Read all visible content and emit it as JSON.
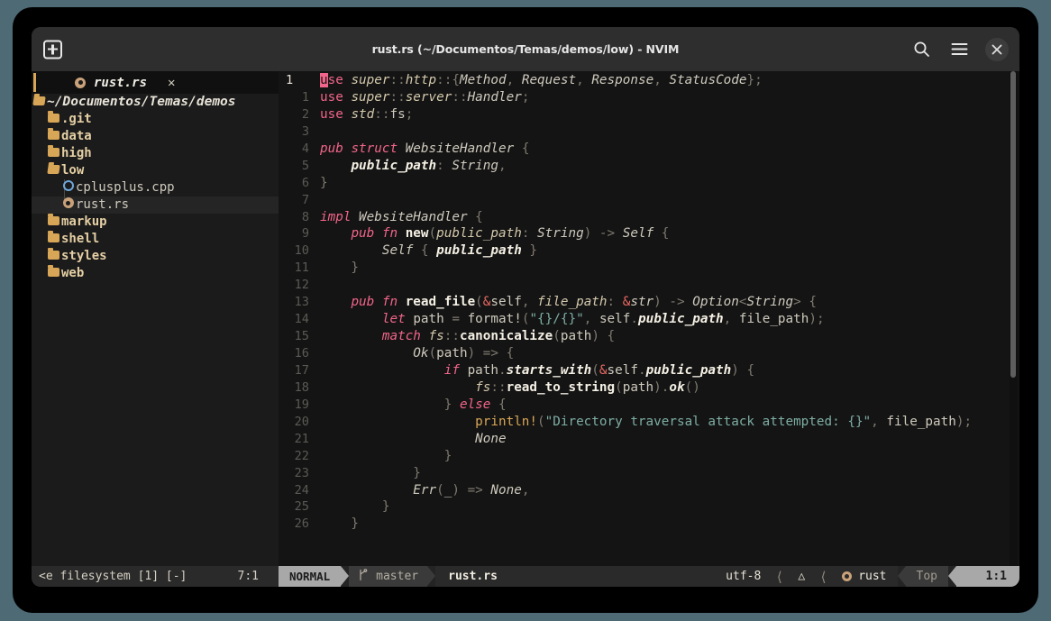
{
  "window": {
    "title": "rust.rs (~/Documentos/Temas/demos/low) - NVIM",
    "new_tab_label": "+",
    "search_icon": "search-icon",
    "menu_icon": "hamburger-menu-icon",
    "close_icon": "close-icon",
    "close_label": "✕"
  },
  "tabline": {
    "tabs": [
      {
        "label": "rust.rs",
        "icon": "rust-file-icon",
        "close_label": "✕",
        "active": true
      }
    ]
  },
  "filetree": {
    "root": {
      "label": "~/Documentos/Temas/demos",
      "icon": "folder-open-icon"
    },
    "items": [
      {
        "label": ".git",
        "icon": "folder-icon",
        "type": "dir",
        "depth": 1,
        "selected": false
      },
      {
        "label": "data",
        "icon": "folder-icon",
        "type": "dir",
        "depth": 1,
        "selected": false
      },
      {
        "label": "high",
        "icon": "folder-icon",
        "type": "dir",
        "depth": 1,
        "selected": false
      },
      {
        "label": "low",
        "icon": "folder-open-icon",
        "type": "dir",
        "depth": 1,
        "selected": false
      },
      {
        "label": "cplusplus.cpp",
        "icon": "cpp-file-icon",
        "type": "file",
        "depth": 2,
        "selected": false
      },
      {
        "label": "rust.rs",
        "icon": "rust-file-icon",
        "type": "file",
        "depth": 2,
        "selected": true
      },
      {
        "label": "markup",
        "icon": "folder-icon",
        "type": "dir",
        "depth": 1,
        "selected": false
      },
      {
        "label": "shell",
        "icon": "folder-icon",
        "type": "dir",
        "depth": 1,
        "selected": false
      },
      {
        "label": "styles",
        "icon": "folder-icon",
        "type": "dir",
        "depth": 1,
        "selected": false
      },
      {
        "label": "web",
        "icon": "folder-icon",
        "type": "dir",
        "depth": 1,
        "selected": false
      }
    ]
  },
  "editor": {
    "language": "rust",
    "cursor_char": "u",
    "lines": [
      {
        "num": "1",
        "current": true,
        "tokens": [
          {
            "t": "u",
            "c": "cursor-blk"
          },
          {
            "t": "se",
            "c": "kw2"
          },
          {
            "t": " ",
            "c": "pl"
          },
          {
            "t": "super",
            "c": "id"
          },
          {
            "t": "::",
            "c": "pn"
          },
          {
            "t": "http",
            "c": "id"
          },
          {
            "t": "::",
            "c": "pn"
          },
          {
            "t": "{",
            "c": "pn"
          },
          {
            "t": "Method",
            "c": "typ"
          },
          {
            "t": ", ",
            "c": "pn"
          },
          {
            "t": "Request",
            "c": "typ"
          },
          {
            "t": ", ",
            "c": "pn"
          },
          {
            "t": "Response",
            "c": "typ"
          },
          {
            "t": ", ",
            "c": "pn"
          },
          {
            "t": "StatusCode",
            "c": "typ"
          },
          {
            "t": "};",
            "c": "pn"
          }
        ]
      },
      {
        "num": "1",
        "current": false,
        "tokens": [
          {
            "t": "use",
            "c": "kw2"
          },
          {
            "t": " ",
            "c": "pl"
          },
          {
            "t": "super",
            "c": "id"
          },
          {
            "t": "::",
            "c": "pn"
          },
          {
            "t": "server",
            "c": "id"
          },
          {
            "t": "::",
            "c": "pn"
          },
          {
            "t": "Handler",
            "c": "typ"
          },
          {
            "t": ";",
            "c": "pn"
          }
        ]
      },
      {
        "num": "2",
        "current": false,
        "tokens": [
          {
            "t": "use",
            "c": "kw2"
          },
          {
            "t": " ",
            "c": "pl"
          },
          {
            "t": "std",
            "c": "id"
          },
          {
            "t": "::",
            "c": "pn"
          },
          {
            "t": "fs",
            "c": "pl"
          },
          {
            "t": ";",
            "c": "pn"
          }
        ]
      },
      {
        "num": "3",
        "current": false,
        "tokens": []
      },
      {
        "num": "4",
        "current": false,
        "tokens": [
          {
            "t": "pub",
            "c": "kw"
          },
          {
            "t": " ",
            "c": "pl"
          },
          {
            "t": "struct",
            "c": "kw"
          },
          {
            "t": " ",
            "c": "pl"
          },
          {
            "t": "WebsiteHandler",
            "c": "typ"
          },
          {
            "t": " {",
            "c": "pn"
          }
        ]
      },
      {
        "num": "5",
        "current": false,
        "tokens": [
          {
            "t": "    ",
            "c": "pl"
          },
          {
            "t": "public_path",
            "c": "fnb"
          },
          {
            "t": ": ",
            "c": "pn"
          },
          {
            "t": "String",
            "c": "typ"
          },
          {
            "t": ",",
            "c": "pn"
          }
        ]
      },
      {
        "num": "6",
        "current": false,
        "tokens": [
          {
            "t": "}",
            "c": "pn"
          }
        ]
      },
      {
        "num": "7",
        "current": false,
        "tokens": []
      },
      {
        "num": "8",
        "current": false,
        "tokens": [
          {
            "t": "impl",
            "c": "kw"
          },
          {
            "t": " ",
            "c": "pl"
          },
          {
            "t": "WebsiteHandler",
            "c": "typ"
          },
          {
            "t": " {",
            "c": "pn"
          }
        ]
      },
      {
        "num": "9",
        "current": false,
        "tokens": [
          {
            "t": "    ",
            "c": "pl"
          },
          {
            "t": "pub",
            "c": "kw"
          },
          {
            "t": " ",
            "c": "pl"
          },
          {
            "t": "fn",
            "c": "kw"
          },
          {
            "t": " ",
            "c": "pl"
          },
          {
            "t": "new",
            "c": "fn"
          },
          {
            "t": "(",
            "c": "pn"
          },
          {
            "t": "public_path",
            "c": "id"
          },
          {
            "t": ": ",
            "c": "pn"
          },
          {
            "t": "String",
            "c": "typ"
          },
          {
            "t": ") ",
            "c": "pn"
          },
          {
            "t": "-> ",
            "c": "pn"
          },
          {
            "t": "Self",
            "c": "typ"
          },
          {
            "t": " {",
            "c": "pn"
          }
        ]
      },
      {
        "num": "10",
        "current": false,
        "tokens": [
          {
            "t": "        ",
            "c": "pl"
          },
          {
            "t": "Self",
            "c": "typ"
          },
          {
            "t": " { ",
            "c": "pn"
          },
          {
            "t": "public_path",
            "c": "fnb"
          },
          {
            "t": " }",
            "c": "pn"
          }
        ]
      },
      {
        "num": "11",
        "current": false,
        "tokens": [
          {
            "t": "    }",
            "c": "pn"
          }
        ]
      },
      {
        "num": "12",
        "current": false,
        "tokens": []
      },
      {
        "num": "13",
        "current": false,
        "tokens": [
          {
            "t": "    ",
            "c": "pl"
          },
          {
            "t": "pub",
            "c": "kw"
          },
          {
            "t": " ",
            "c": "pl"
          },
          {
            "t": "fn",
            "c": "kw"
          },
          {
            "t": " ",
            "c": "pl"
          },
          {
            "t": "read_file",
            "c": "fn"
          },
          {
            "t": "(",
            "c": "pn"
          },
          {
            "t": "&",
            "c": "amp"
          },
          {
            "t": "self",
            "c": "pl"
          },
          {
            "t": ", ",
            "c": "pn"
          },
          {
            "t": "file_path",
            "c": "id"
          },
          {
            "t": ": ",
            "c": "pn"
          },
          {
            "t": "&",
            "c": "amp"
          },
          {
            "t": "str",
            "c": "typ"
          },
          {
            "t": ") ",
            "c": "pn"
          },
          {
            "t": "-> ",
            "c": "pn"
          },
          {
            "t": "Option",
            "c": "typ"
          },
          {
            "t": "<",
            "c": "pn"
          },
          {
            "t": "String",
            "c": "typ"
          },
          {
            "t": "> {",
            "c": "pn"
          }
        ]
      },
      {
        "num": "14",
        "current": false,
        "tokens": [
          {
            "t": "        ",
            "c": "pl"
          },
          {
            "t": "let",
            "c": "kw"
          },
          {
            "t": " ",
            "c": "pl"
          },
          {
            "t": "path",
            "c": "pl"
          },
          {
            "t": " = ",
            "c": "pn"
          },
          {
            "t": "format!",
            "c": "pl"
          },
          {
            "t": "(",
            "c": "pn"
          },
          {
            "t": "\"{}/{}\"",
            "c": "str"
          },
          {
            "t": ", ",
            "c": "pn"
          },
          {
            "t": "self",
            "c": "pl"
          },
          {
            "t": ".",
            "c": "pn"
          },
          {
            "t": "public_path",
            "c": "fnb"
          },
          {
            "t": ", ",
            "c": "pn"
          },
          {
            "t": "file_path",
            "c": "pl"
          },
          {
            "t": ");",
            "c": "pn"
          }
        ]
      },
      {
        "num": "15",
        "current": false,
        "tokens": [
          {
            "t": "        ",
            "c": "pl"
          },
          {
            "t": "match",
            "c": "kw"
          },
          {
            "t": " ",
            "c": "pl"
          },
          {
            "t": "fs",
            "c": "id"
          },
          {
            "t": "::",
            "c": "pn"
          },
          {
            "t": "canonicalize",
            "c": "fn"
          },
          {
            "t": "(",
            "c": "pn"
          },
          {
            "t": "path",
            "c": "pl"
          },
          {
            "t": ") {",
            "c": "pn"
          }
        ]
      },
      {
        "num": "16",
        "current": false,
        "tokens": [
          {
            "t": "            ",
            "c": "pl"
          },
          {
            "t": "Ok",
            "c": "typ"
          },
          {
            "t": "(",
            "c": "pn"
          },
          {
            "t": "path",
            "c": "pl"
          },
          {
            "t": ") ",
            "c": "pn"
          },
          {
            "t": "=> {",
            "c": "pn"
          }
        ]
      },
      {
        "num": "17",
        "current": false,
        "tokens": [
          {
            "t": "                ",
            "c": "pl"
          },
          {
            "t": "if",
            "c": "kw"
          },
          {
            "t": " ",
            "c": "pl"
          },
          {
            "t": "path",
            "c": "pl"
          },
          {
            "t": ".",
            "c": "pn"
          },
          {
            "t": "starts_with",
            "c": "fnb"
          },
          {
            "t": "(",
            "c": "pn"
          },
          {
            "t": "&",
            "c": "amp"
          },
          {
            "t": "self",
            "c": "pl"
          },
          {
            "t": ".",
            "c": "pn"
          },
          {
            "t": "public_path",
            "c": "fnb"
          },
          {
            "t": ") {",
            "c": "pn"
          }
        ]
      },
      {
        "num": "18",
        "current": false,
        "tokens": [
          {
            "t": "                    ",
            "c": "pl"
          },
          {
            "t": "fs",
            "c": "id"
          },
          {
            "t": "::",
            "c": "pn"
          },
          {
            "t": "read_to_string",
            "c": "fn"
          },
          {
            "t": "(",
            "c": "pn"
          },
          {
            "t": "path",
            "c": "pl"
          },
          {
            "t": ").",
            "c": "pn"
          },
          {
            "t": "ok",
            "c": "fnb"
          },
          {
            "t": "()",
            "c": "pn"
          }
        ]
      },
      {
        "num": "19",
        "current": false,
        "tokens": [
          {
            "t": "                ",
            "c": "pl"
          },
          {
            "t": "} ",
            "c": "pn"
          },
          {
            "t": "else",
            "c": "kw"
          },
          {
            "t": " {",
            "c": "pn"
          }
        ]
      },
      {
        "num": "20",
        "current": false,
        "tokens": [
          {
            "t": "                    ",
            "c": "pl"
          },
          {
            "t": "println!",
            "c": "mac"
          },
          {
            "t": "(",
            "c": "pn"
          },
          {
            "t": "\"Directory traversal attack attempted: {}\"",
            "c": "str"
          },
          {
            "t": ", ",
            "c": "pn"
          },
          {
            "t": "file_path",
            "c": "pl"
          },
          {
            "t": ");",
            "c": "pn"
          }
        ]
      },
      {
        "num": "21",
        "current": false,
        "tokens": [
          {
            "t": "                    ",
            "c": "pl"
          },
          {
            "t": "None",
            "c": "typ"
          }
        ]
      },
      {
        "num": "22",
        "current": false,
        "tokens": [
          {
            "t": "                }",
            "c": "pn"
          }
        ]
      },
      {
        "num": "23",
        "current": false,
        "tokens": [
          {
            "t": "            }",
            "c": "pn"
          }
        ]
      },
      {
        "num": "24",
        "current": false,
        "tokens": [
          {
            "t": "            ",
            "c": "pl"
          },
          {
            "t": "Err",
            "c": "typ"
          },
          {
            "t": "(",
            "c": "pn"
          },
          {
            "t": "_",
            "c": "pl"
          },
          {
            "t": ") ",
            "c": "pn"
          },
          {
            "t": "=> ",
            "c": "pn"
          },
          {
            "t": "None",
            "c": "typ"
          },
          {
            "t": ",",
            "c": "pn"
          }
        ]
      },
      {
        "num": "25",
        "current": false,
        "tokens": [
          {
            "t": "        }",
            "c": "pn"
          }
        ]
      },
      {
        "num": "26",
        "current": false,
        "tokens": [
          {
            "t": "    }",
            "c": "pn"
          }
        ]
      }
    ]
  },
  "statusline": {
    "tree_label": "<e filesystem [1] [-]",
    "tree_position": "7:1",
    "mode": "NORMAL",
    "branch_icon": "git-branch-icon",
    "branch": "master",
    "filename": "rust.rs",
    "encoding": "utf-8",
    "fileformat_icon": "unix-lf-icon",
    "language_icon": "rust-icon",
    "language": "rust",
    "scroll": "Top",
    "position": "1:1"
  }
}
